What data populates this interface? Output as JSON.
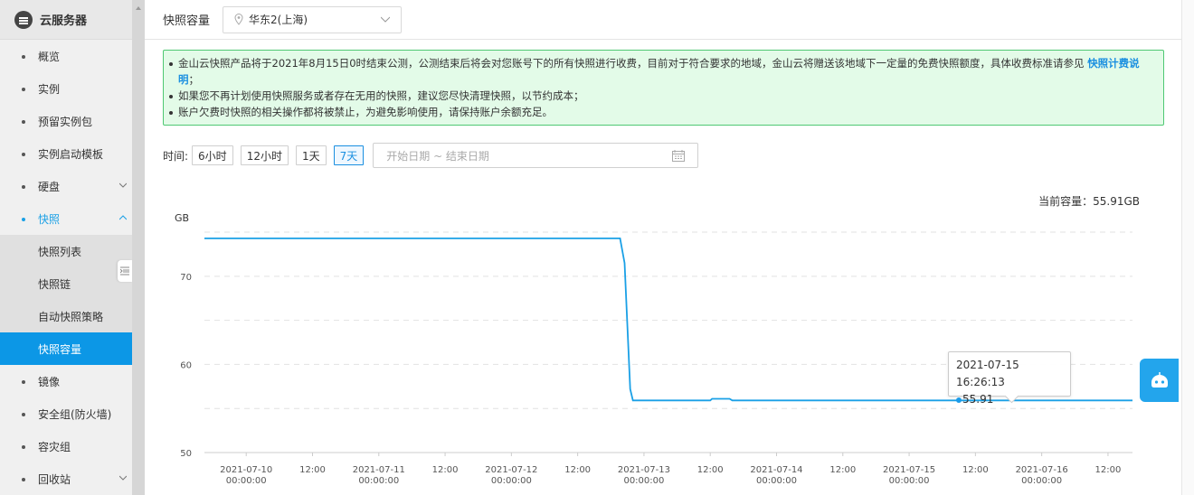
{
  "sidebar": {
    "title": "云服务器",
    "items": [
      {
        "label": "概览"
      },
      {
        "label": "实例"
      },
      {
        "label": "预留实例包"
      },
      {
        "label": "实例启动模板"
      },
      {
        "label": "硬盘"
      },
      {
        "label": "快照"
      },
      {
        "label": "镜像"
      },
      {
        "label": "安全组(防火墙)"
      },
      {
        "label": "容灾组"
      },
      {
        "label": "回收站"
      }
    ],
    "snapshot_sub": [
      {
        "label": "快照列表"
      },
      {
        "label": "快照链"
      },
      {
        "label": "自动快照策略"
      },
      {
        "label": "快照容量"
      }
    ]
  },
  "header": {
    "page_title": "快照容量",
    "region": "华东2(上海)"
  },
  "notice": {
    "line1": "金山云快照产品将于2021年8月15日0时结束公测，公测结束后将会对您账号下的所有快照进行收费，目前对于符合要求的地域，金山云将赠送该地域下一定量的免费快照额度，具体收费标准请参见 ",
    "line1_link": "快照计费说明",
    "line1_end": "；",
    "line2": "如果您不再计划使用快照服务或者存在无用的快照，建议您尽快清理快照，以节约成本；",
    "line3": "账户欠费时快照的相关操作都将被禁止，为避免影响使用，请保持账户余额充足。"
  },
  "time_filter": {
    "label": "时间:",
    "buttons": [
      "6小时",
      "12小时",
      "1天",
      "7天"
    ],
    "active": "7天",
    "date_placeholder": "开始日期 ~ 结束日期"
  },
  "current_capacity": "当前容量：55.91GB",
  "tooltip": {
    "time": "2021-07-15 16:26:13",
    "value": "55.91"
  },
  "colors": {
    "accent": "#0c97e6",
    "line": "#1aa0e6",
    "notice_bg": "#e3fbe8",
    "notice_border": "#4fc873"
  },
  "chart_data": {
    "type": "line",
    "ylabel": "GB",
    "ylim": [
      50,
      79
    ],
    "yticks": [
      50,
      60,
      70
    ],
    "xticks": [
      [
        "2021-07-10",
        "00:00:00"
      ],
      [
        "12:00",
        ""
      ],
      [
        "2021-07-11",
        "00:00:00"
      ],
      [
        "12:00",
        ""
      ],
      [
        "2021-07-12",
        "00:00:00"
      ],
      [
        "12:00",
        ""
      ],
      [
        "2021-07-13",
        "00:00:00"
      ],
      [
        "12:00",
        ""
      ],
      [
        "2021-07-14",
        "00:00:00"
      ],
      [
        "12:00",
        ""
      ],
      [
        "2021-07-15",
        "00:00:00"
      ],
      [
        "12:00",
        ""
      ],
      [
        "2021-07-16",
        "00:00:00"
      ],
      [
        "12:00",
        ""
      ]
    ],
    "xrange": [
      "2021-07-09 16:26",
      "2021-07-16 16:26"
    ],
    "series": [
      {
        "points": [
          [
            "2021-07-09 16:26",
            74.3
          ],
          [
            "2021-07-12 19:40",
            74.3
          ],
          [
            "2021-07-12 20:30",
            71.5
          ],
          [
            "2021-07-12 21:30",
            57.2
          ],
          [
            "2021-07-12 22:00",
            55.91
          ],
          [
            "2021-07-13 12:00",
            55.91
          ],
          [
            "2021-07-13 12:20",
            56.1
          ],
          [
            "2021-07-13 15:30",
            56.1
          ],
          [
            "2021-07-13 16:00",
            55.91
          ],
          [
            "2021-07-16 16:26",
            55.91
          ]
        ]
      }
    ]
  }
}
